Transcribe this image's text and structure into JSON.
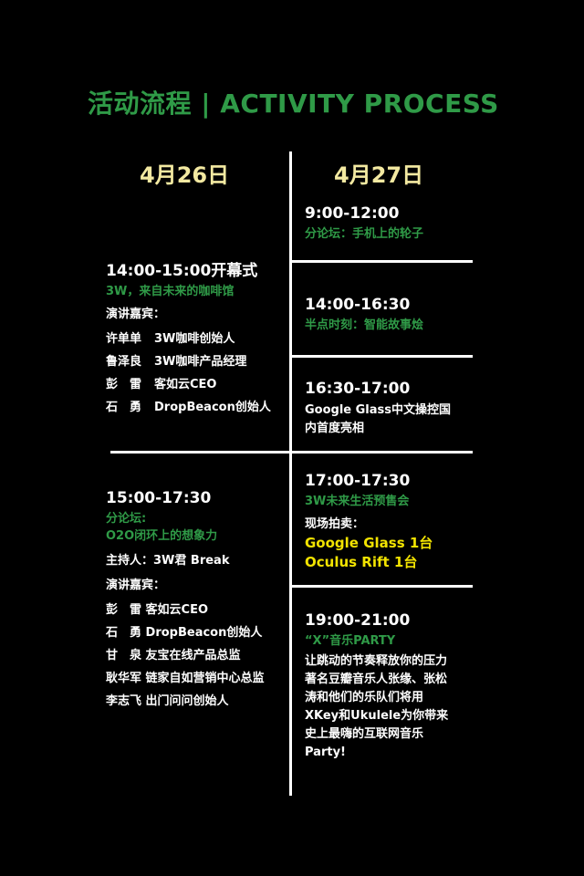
{
  "title": "活动流程 | ACTIVITY PROCESS",
  "left": {
    "date": "4月26日",
    "session1": {
      "time": "14:00-15:00开幕式",
      "subtitle": "3W，来自未来的咖啡馆",
      "speakers_label": "演讲嘉宾：",
      "speakers": [
        {
          "name": "许单单",
          "role": "3W咖啡创始人"
        },
        {
          "name": "鲁泽良",
          "role": "3W咖啡产品经理"
        },
        {
          "name": "彭　雷",
          "role": "客如云CEO"
        },
        {
          "name": "石　勇",
          "role": "DropBeacon创始人"
        }
      ]
    },
    "session2": {
      "time": "15:00-17:30",
      "forum_label": "分论坛:",
      "forum_title": "O2O闭环上的想象力",
      "host": "主持人：3W君 Break",
      "speakers_label": "演讲嘉宾：",
      "speakers": [
        "彭　雷 客如云CEO",
        "石　勇 DropBeacon创始人",
        "甘　泉 友宝在线产品总监",
        "耿华军 链家自如营销中心总监",
        "李志飞 出门问问创始人"
      ]
    }
  },
  "right": {
    "date": "4月27日",
    "s1": {
      "time": "9:00-12:00",
      "desc": "分论坛：手机上的轮子"
    },
    "s2": {
      "time": "14:00-16:30",
      "desc": "半点时刻：智能故事烩"
    },
    "s3": {
      "time": "16:30-17:00",
      "desc_lines": [
        "Google Glass中文操控国",
        "内首度亮相"
      ]
    },
    "s4": {
      "time": "17:00-17:30",
      "desc": "3W未来生活预售会",
      "auction_label": "现场拍卖：",
      "items": [
        "Google Glass 1台",
        "Oculus Rift 1台"
      ]
    },
    "s5": {
      "time": "19:00-21:00",
      "desc": "“X”音乐PARTY",
      "body_lines": [
        "让跳动的节奏释放你的压力",
        "著名豆瓣音乐人张缘、张松",
        "涛和他们的乐队们将用",
        "XKey和Ukulele为你带来",
        "史上最嗨的互联网音乐",
        "Party!"
      ]
    }
  },
  "colors": {
    "green": "#2f9a47",
    "cream": "#f3e9a1",
    "yellow": "#f2e300"
  }
}
